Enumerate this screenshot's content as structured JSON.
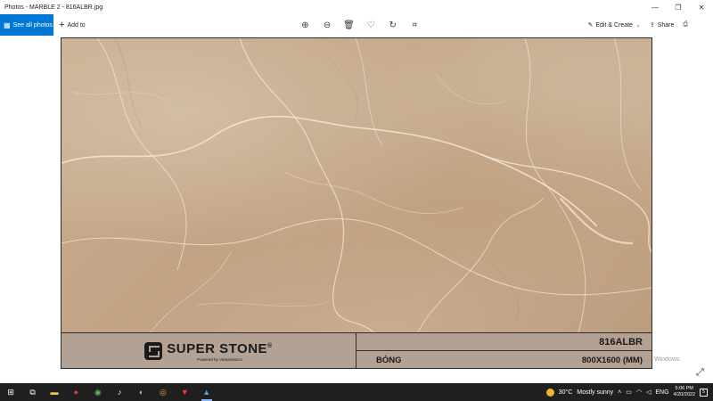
{
  "window": {
    "title": "Photos - MARBLE 2 - 816ALBR.jpg",
    "controls": {
      "minimize": "—",
      "restore": "❐",
      "close": "✕"
    }
  },
  "toolbar": {
    "see_all_label": "See all photos",
    "add_to_label": "Add to",
    "tools": [
      {
        "name": "zoom-in-icon",
        "glyph": "⊕"
      },
      {
        "name": "zoom-out-icon",
        "glyph": "⊖"
      },
      {
        "name": "delete-icon",
        "glyph": "🗑"
      },
      {
        "name": "favorite-icon",
        "glyph": "♡"
      },
      {
        "name": "rotate-icon",
        "glyph": "↻"
      },
      {
        "name": "crop-icon",
        "glyph": "⌗"
      }
    ],
    "edit_create_label": "Edit & Create",
    "share_label": "Share"
  },
  "tile": {
    "brand_name": "SUPER STONE",
    "brand_mark": "®",
    "brand_sub": "Powered by Vietceramics",
    "code": "816ALBR",
    "finish": "BÓNG",
    "size": "800X1600 (MM)"
  },
  "overlay": {
    "activate_text": "Windows."
  },
  "taskbar": {
    "weather_temp": "30°C",
    "weather_text": "Mostly sunny",
    "language": "ENG",
    "time": "5:06 PM",
    "date": "4/20/2022",
    "notification_count": "5",
    "colors": {
      "bg": "#1f1f1f",
      "accent": "#0078d7"
    }
  }
}
